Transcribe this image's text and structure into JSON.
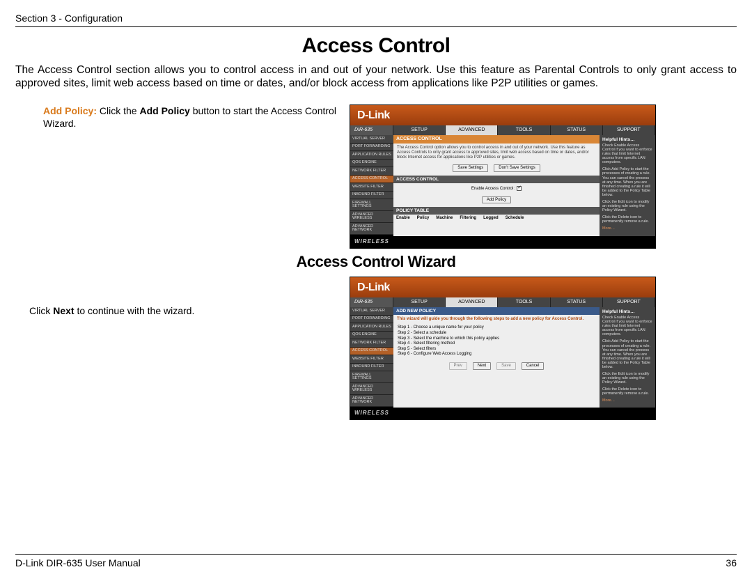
{
  "header": {
    "section": "Section 3 - Configuration"
  },
  "title": "Access Control",
  "intro": "The Access Control section allows you to control access in and out of your network. Use this feature as Parental Controls to only grant access to approved sites, limit web access based on time or dates, and/or block access from applications like P2P utilities or games.",
  "addPolicy": {
    "label": "Add Policy:",
    "prefix": "Click the ",
    "bold": "Add Policy",
    "suffix": " button to start the Access Control Wizard."
  },
  "subheading": "Access Control Wizard",
  "wizardNote": {
    "prefix": "Click ",
    "bold": "Next",
    "suffix": " to continue with the wizard."
  },
  "router": {
    "brand": "D-Link",
    "model": "DIR-635",
    "tabs": [
      "SETUP",
      "ADVANCED",
      "TOOLS",
      "STATUS",
      "SUPPORT"
    ],
    "sidebar": [
      "VIRTUAL SERVER",
      "PORT FORWARDING",
      "APPLICATION RULES",
      "QOS ENGINE",
      "NETWORK FILTER",
      "ACCESS CONTROL",
      "WEBSITE FILTER",
      "INBOUND FILTER",
      "FIREWALL SETTINGS",
      "ADVANCED WIRELESS",
      "ADVANCED NETWORK"
    ],
    "ac_title": "ACCESS CONTROL",
    "ac_desc": "The Access Control option allows you to control access in and out of your network. Use this feature as Access Controls to only grant access to approved sites, limit web access based on time or dates, and/or block Internet access for applications like P2P utilities or games.",
    "btn_save": "Save Settings",
    "btn_dont": "Don't Save Settings",
    "enable_label": "Enable Access Control :",
    "btn_addpolicy": "Add Policy",
    "policy_table": "POLICY TABLE",
    "th": [
      "Enable",
      "Policy",
      "Machine",
      "Filtering",
      "Logged",
      "Schedule"
    ],
    "hints_title": "Helpful Hints…",
    "hint1": "Check Enable Access Control if you want to enforce rules that limit Internet access from specific LAN computers.",
    "hint2": "Click Add Policy to start the processes of creating a rule. You can cancel the process at any time. When you are finished creating a rule it will be added to the Policy Table below.",
    "hint3": "Click the Edit icon to modify an existing rule using the Policy Wizard.",
    "hint4": "Click the Delete icon to permanently remove a rule.",
    "more": "More…",
    "wireless": "WIRELESS",
    "wiz_title": "ADD NEW POLICY",
    "wiz_intro": "This wizard will guide you through the following steps to add a new policy for Access Control.",
    "steps": [
      "Step 1 - Choose a unique name for your policy",
      "Step 2 - Select a schedule",
      "Step 3 - Select the machine to which this policy applies",
      "Step 4 - Select filtering method",
      "Step 5 - Select filters",
      "Step 6 - Configure Web Access Logging"
    ],
    "wbtn_prev": "Prev",
    "wbtn_next": "Next",
    "wbtn_save": "Save",
    "wbtn_cancel": "Cancel"
  },
  "footer": {
    "left": "D-Link DIR-635 User Manual",
    "page": "36"
  }
}
